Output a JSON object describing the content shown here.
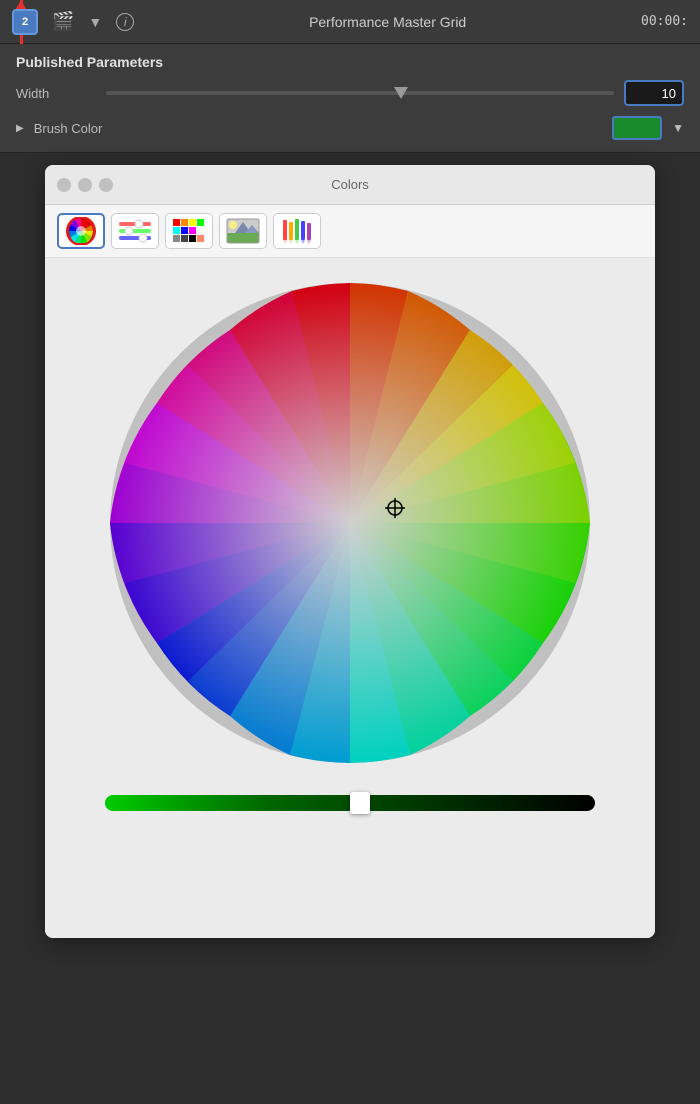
{
  "topbar": {
    "badge": "2",
    "title": "Performance Master Grid",
    "time": "00:00:",
    "icons": {
      "film": "🎬",
      "dropdown": "▼",
      "info": "i"
    }
  },
  "published_params": {
    "title": "Published Parameters",
    "width": {
      "label": "Width",
      "value": "10",
      "slider_percent": 58
    },
    "brush_color": {
      "label": "Brush Color",
      "color": "#1a8a2e"
    }
  },
  "colors_panel": {
    "title": "Colors",
    "window_buttons": [
      "close",
      "minimize",
      "maximize"
    ],
    "modes": [
      {
        "name": "color-wheel-mode",
        "label": "Wheel"
      },
      {
        "name": "sliders-mode",
        "label": "Sliders"
      },
      {
        "name": "grid-mode",
        "label": "Grid"
      },
      {
        "name": "image-mode",
        "label": "Image"
      },
      {
        "name": "pencils-mode",
        "label": "Pencils"
      }
    ],
    "brightness_slider": {
      "value": 52
    }
  }
}
